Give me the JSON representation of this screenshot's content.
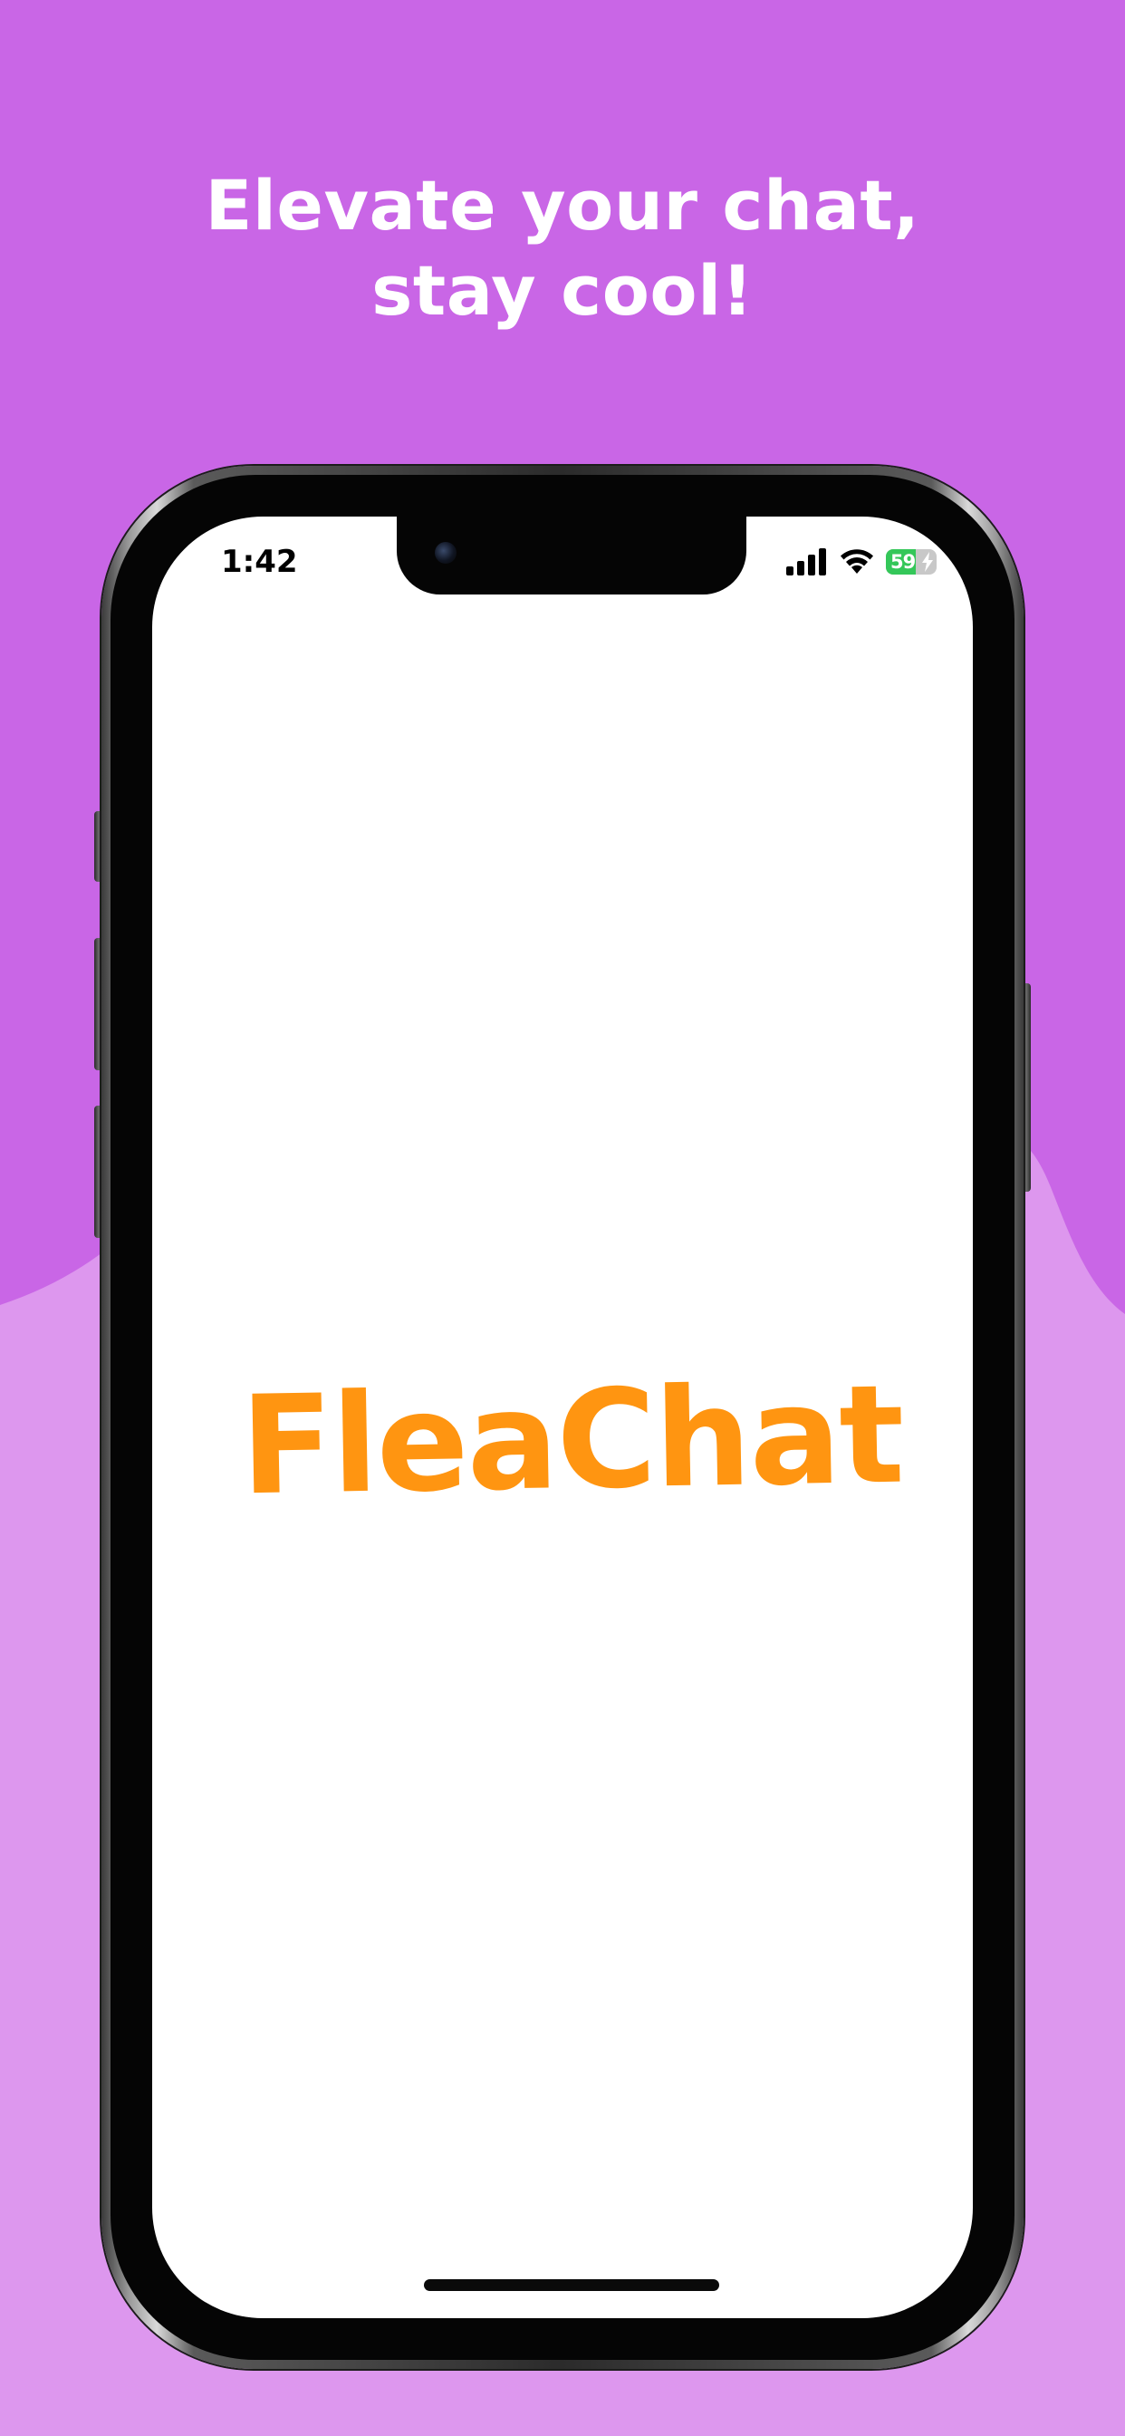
{
  "headline": {
    "line1": "Elevate your chat,",
    "line2": "stay cool!"
  },
  "status_bar": {
    "time": "1:42",
    "battery_level": "59",
    "battery_fraction": 0.59,
    "icons": [
      "signal-icon",
      "wifi-icon",
      "battery-icon",
      "charging-bolt-icon"
    ]
  },
  "app": {
    "brand_name": "FleaChat"
  },
  "colors": {
    "background_top": "#c966e6",
    "background_bottom": "#dd97ee",
    "brand": "#ff9511",
    "battery_fill": "#34c759",
    "screen": "#ffffff"
  }
}
